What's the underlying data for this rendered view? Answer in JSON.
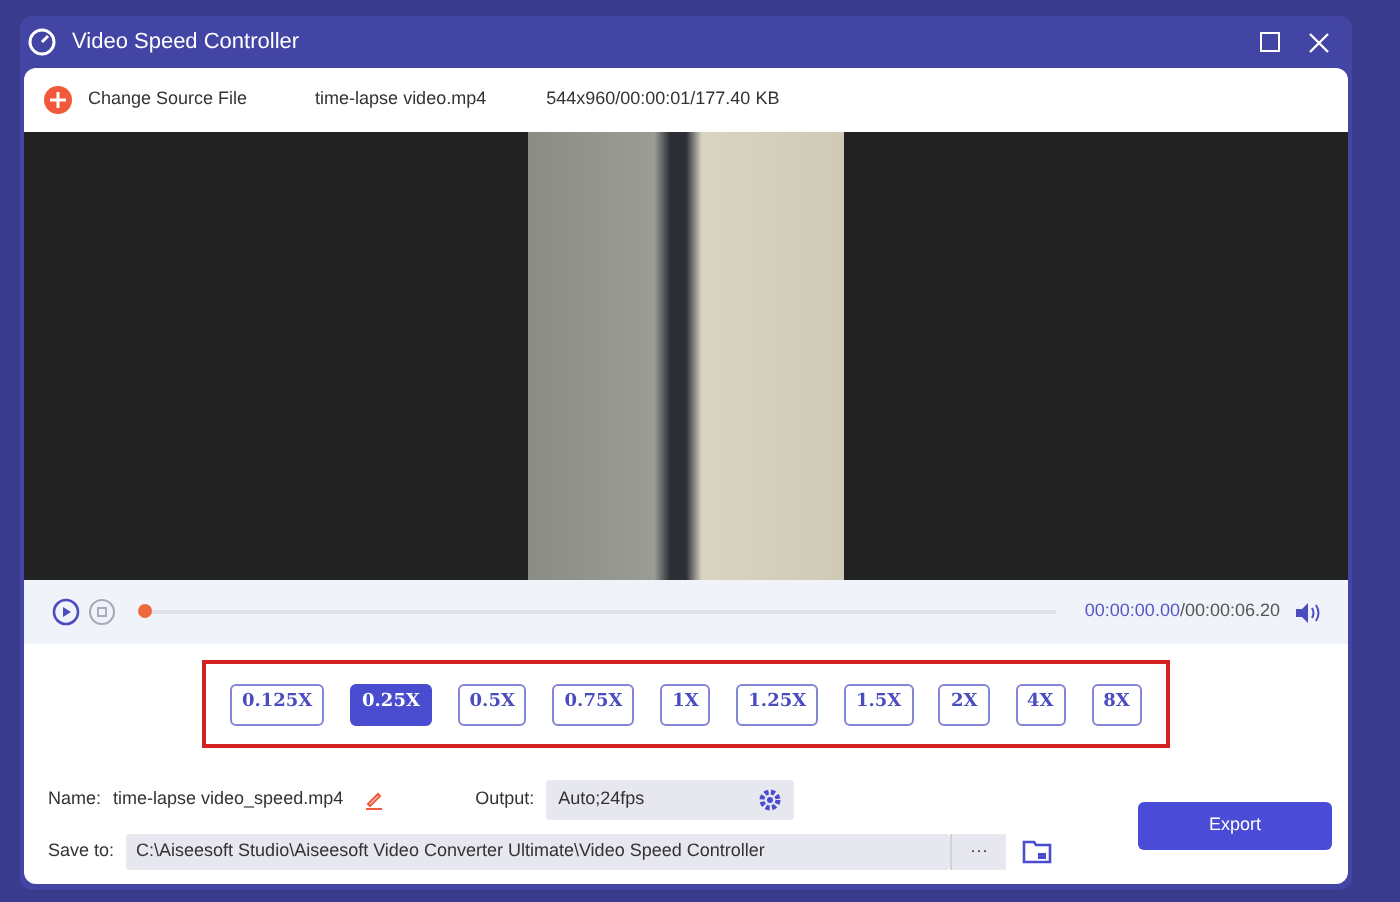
{
  "window": {
    "title": "Video Speed Controller"
  },
  "source": {
    "button": "Change Source File",
    "file": "time-lapse video.mp4",
    "info": "544x960/00:00:01/177.40 KB"
  },
  "player": {
    "current": "00:00:00.00",
    "total": "/00:00:06.20",
    "level": 0
  },
  "speeds": [
    {
      "label": "0.125X",
      "selected": false
    },
    {
      "label": "0.25X",
      "selected": true
    },
    {
      "label": "0.5X",
      "selected": false
    },
    {
      "label": "0.75X",
      "selected": false
    },
    {
      "label": "1X",
      "selected": false
    },
    {
      "label": "1.25X",
      "selected": false
    },
    {
      "label": "1.5X",
      "selected": false
    },
    {
      "label": "2X",
      "selected": false
    },
    {
      "label": "4X",
      "selected": false
    },
    {
      "label": "8X",
      "selected": false
    }
  ],
  "name": {
    "label": "Name:",
    "value": "time-lapse video_speed.mp4"
  },
  "output": {
    "label": "Output:",
    "value": "Auto;24fps"
  },
  "save": {
    "label": "Save to:",
    "value": "C:\\Aiseesoft Studio\\Aiseesoft Video Converter Ultimate\\Video Speed Controller",
    "more": "···"
  },
  "export": "Export"
}
